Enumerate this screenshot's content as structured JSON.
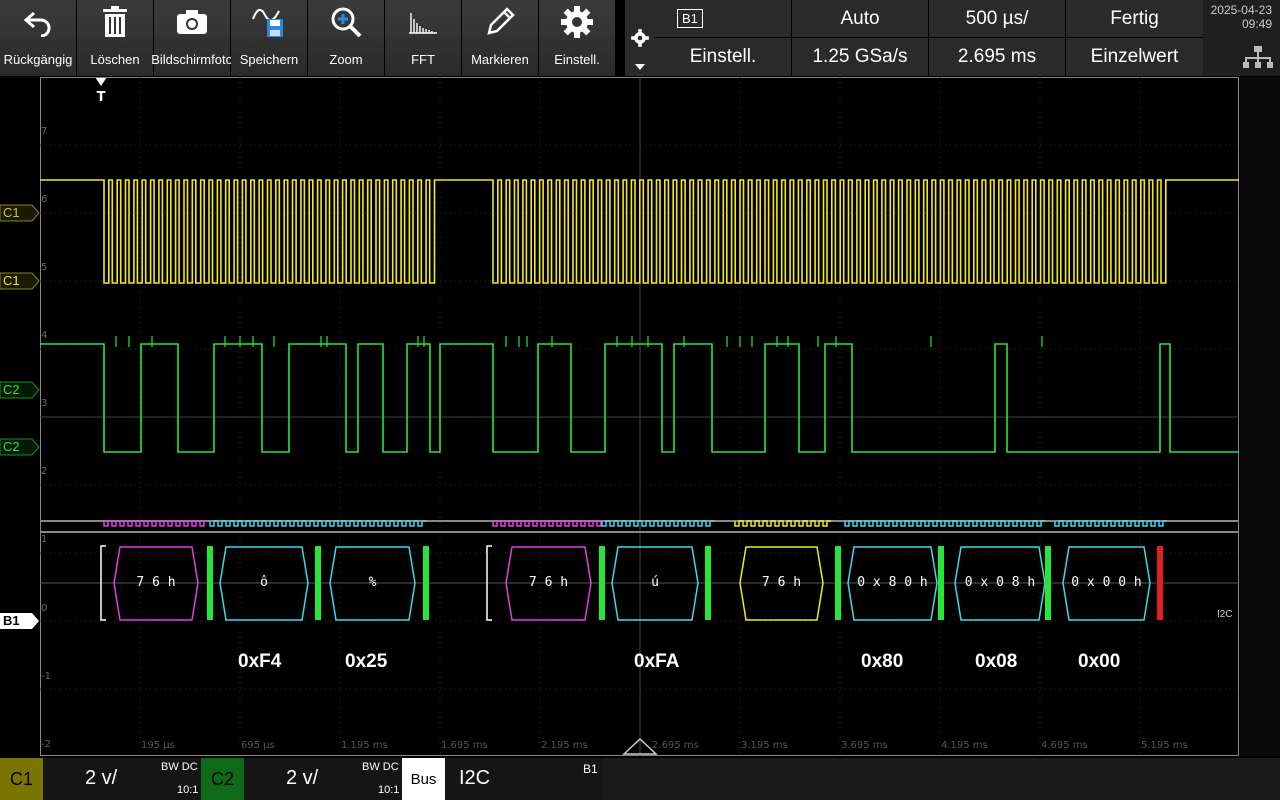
{
  "toolbar": {
    "undo": "Rückgängig",
    "delete": "Löschen",
    "screenshot": "Bildschirmfoto",
    "save": "Speichern",
    "zoom": "Zoom",
    "fft": "FFT",
    "mark": "Markieren",
    "settings": "Einstell."
  },
  "params": {
    "bus": "B1",
    "bus_setup": "Einstell.",
    "trigger_mode": "Auto",
    "sample_rate": "1.25 GSa/s",
    "time_scale": "500 µs/",
    "trigger_pos": "2.695 ms",
    "acq_state": "Fertig",
    "acq_mode": "Einzelwert"
  },
  "clock": {
    "date": "2025-04-23",
    "time": "09:49"
  },
  "channels": {
    "c1": "C1",
    "c2": "C2",
    "b1": "B1",
    "b1_proto": "I2C",
    "c1_color": "#f4e81f",
    "c2_color": "#27e63a"
  },
  "trigger_marker": "T",
  "y_ticks": [
    "7",
    "6",
    "5",
    "4",
    "3",
    "2",
    "1",
    "0",
    "-1",
    "-2"
  ],
  "x_ticks": [
    "195 µs",
    "695 µs",
    "1.195 ms",
    "1.695 ms",
    "2.195 ms",
    "2.695 ms",
    "3.195 ms",
    "3.695 ms",
    "4.195 ms",
    "4.695 ms",
    "5.195 ms"
  ],
  "bus_frames": [
    "7 6 h",
    "ô",
    "%",
    "7 6 h",
    "ú",
    "7 6 h",
    "0 x 8 0 h",
    "0 x 0 8 h",
    "0 x 0 0 h"
  ],
  "decode_labels": [
    "0xF4",
    "0x25",
    "0xFA",
    "0x80",
    "0x08",
    "0x00"
  ],
  "bottom": {
    "c1": "C1",
    "c1_scale": "2 v/",
    "c1_bw": "BW DC",
    "c1_probe": "10:1",
    "c2": "C2",
    "c2_scale": "2 v/",
    "c2_bw": "BW DC",
    "c2_probe": "10:1",
    "bus": "Bus",
    "bus_proto": "I2C",
    "bus_id": "B1"
  }
}
